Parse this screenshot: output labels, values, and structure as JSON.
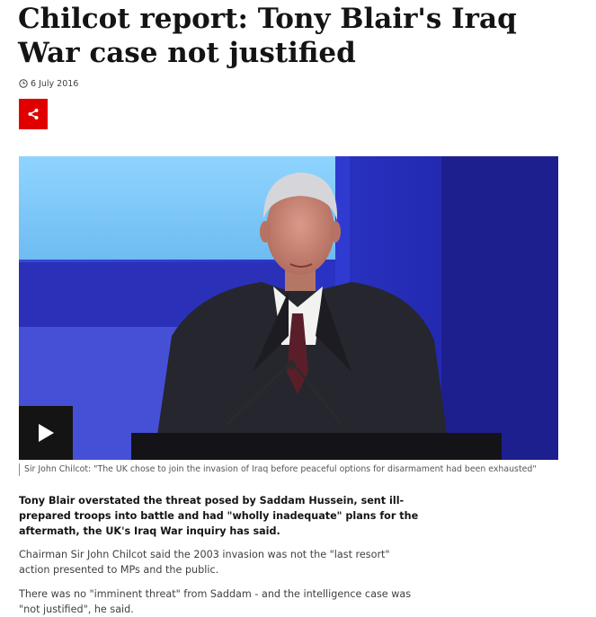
{
  "article": {
    "title": "Chilcot report: Tony Blair's Iraq War case not justified",
    "date": "6 July 2016",
    "share_icon": "share-icon",
    "media": {
      "play_icon": "play-icon",
      "caption": "Sir John Chilcot: \"The UK chose to join the invasion of Iraq before peaceful options for disarmament had been exhausted\""
    },
    "lead": "Tony Blair overstated the threat posed by Saddam Hussein, sent ill-prepared troops into battle and had \"wholly inadequate\" plans for the aftermath, the UK's Iraq War inquiry has said.",
    "paragraphs": [
      "Chairman Sir John Chilcot said the 2003 invasion was not the \"last resort\" action presented to MPs and the public.",
      "There was no \"imminent threat\" from Saddam - and the intelligence case was \"not justified\", he said."
    ]
  },
  "colors": {
    "accent": "#e00000",
    "text": "#141414",
    "caption": "#545658"
  }
}
